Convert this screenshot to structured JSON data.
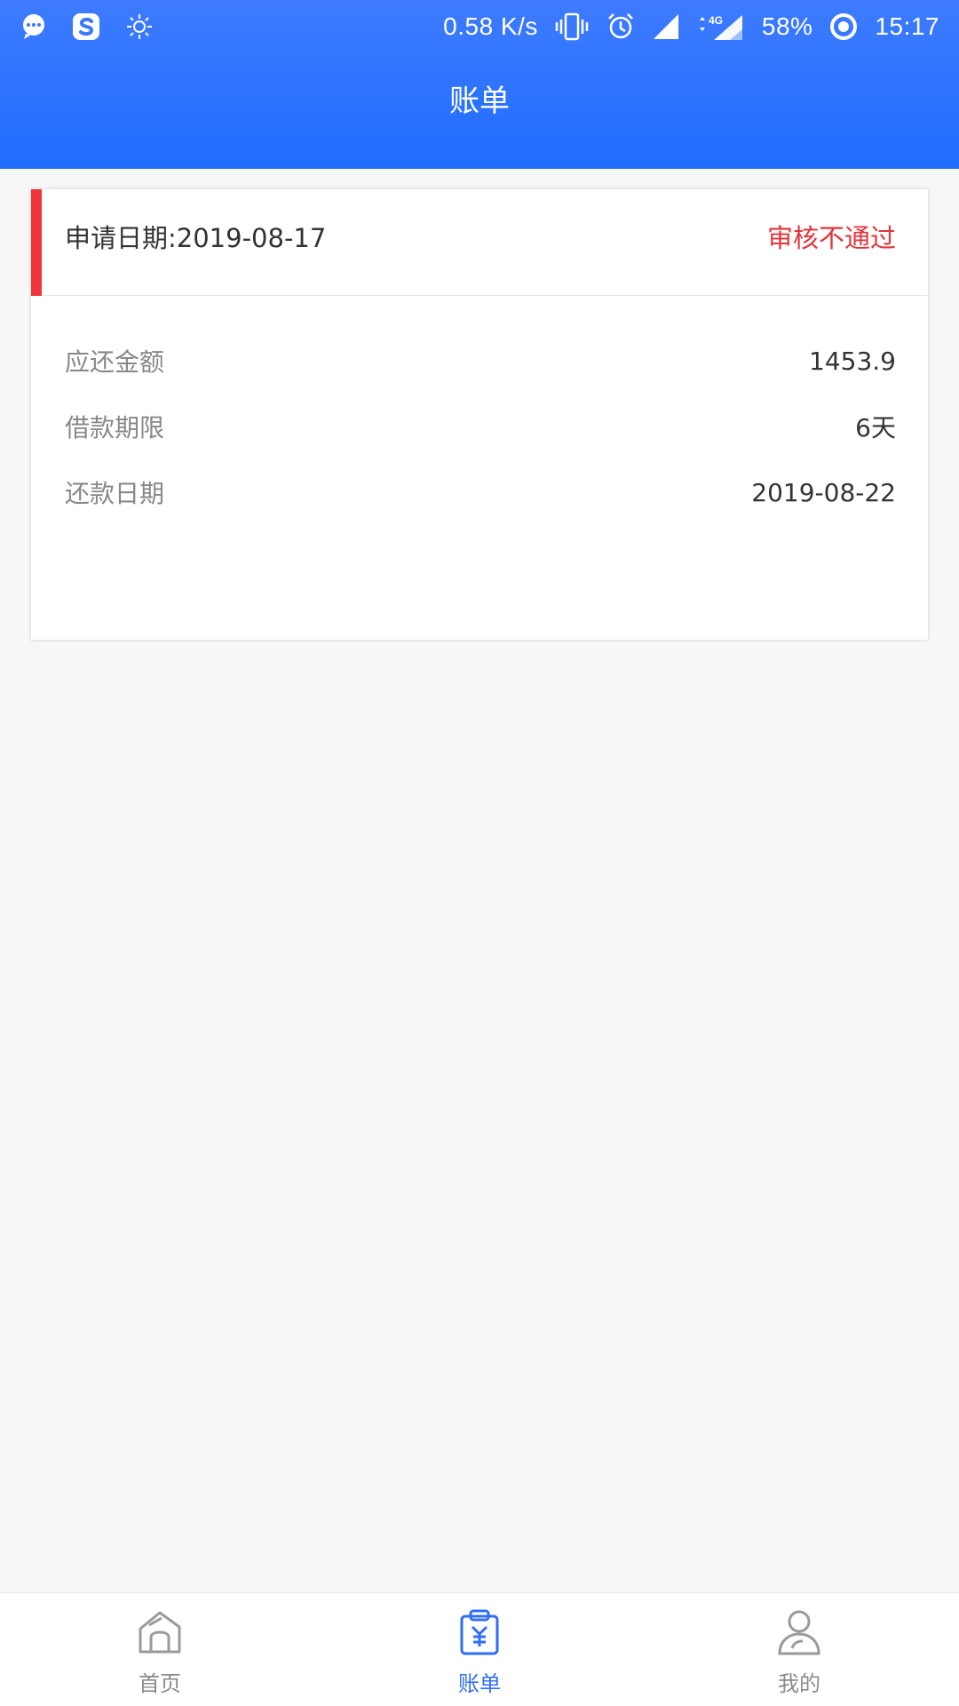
{
  "status_bar": {
    "net_speed": "0.58 K/s",
    "network": "4G",
    "battery": "58%",
    "time": "15:17"
  },
  "header": {
    "title": "账单"
  },
  "bill_card": {
    "apply_date": "申请日期:2019-08-17",
    "status": "审核不通过",
    "rows": [
      {
        "label": "应还金额",
        "value": "1453.9"
      },
      {
        "label": "借款期限",
        "value": "6天"
      },
      {
        "label": "还款日期",
        "value": "2019-08-22"
      }
    ]
  },
  "tabbar": {
    "tabs": [
      {
        "label": "首页",
        "icon": "home-icon"
      },
      {
        "label": "账单",
        "icon": "bill-icon"
      },
      {
        "label": "我的",
        "icon": "profile-icon"
      }
    ],
    "active_color": "#2f6ef5",
    "inactive_color": "#8b8b8b"
  },
  "colors": {
    "header_blue": "#1f6dff",
    "status_red": "#e3343a",
    "accent_red": "#f0353a"
  }
}
